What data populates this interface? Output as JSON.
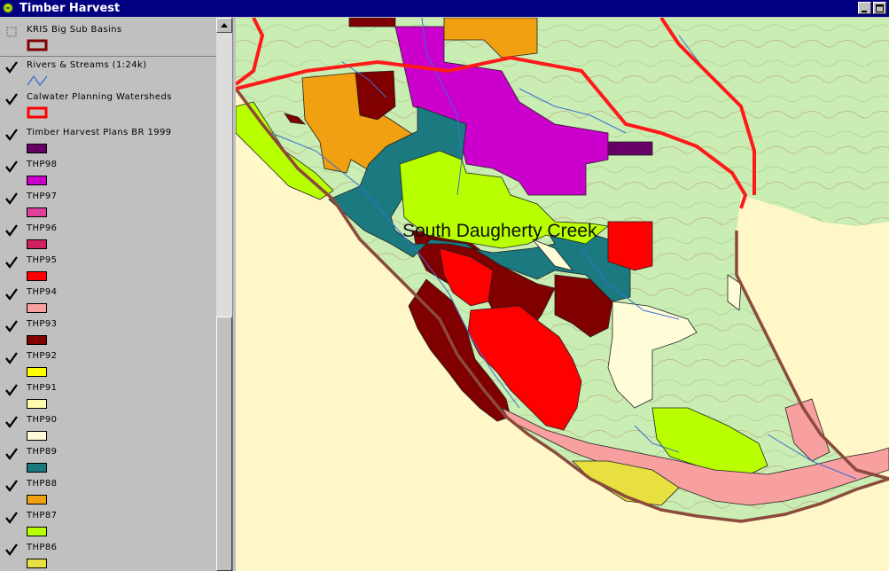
{
  "window": {
    "title": "Timber Harvest"
  },
  "toc": {
    "layers": [
      {
        "name": "KRIS Big Sub Basins",
        "checked": false,
        "symbol": "hollow-box",
        "color": "#800000"
      },
      {
        "name": "Rivers & Streams (1:24k)",
        "checked": true,
        "symbol": "line",
        "color": "#3366cc"
      },
      {
        "name": "Calwater Planning Watersheds",
        "checked": true,
        "symbol": "hollow-box",
        "color": "#ff0000"
      },
      {
        "name": "Timber Harvest Plans BR 1999",
        "checked": true,
        "symbol": "fill",
        "color": "#660066"
      },
      {
        "name": "THP98",
        "checked": true,
        "symbol": "fill",
        "color": "#cc00cc"
      },
      {
        "name": "THP97",
        "checked": true,
        "symbol": "fill",
        "color": "#e0409a"
      },
      {
        "name": "THP96",
        "checked": true,
        "symbol": "fill",
        "color": "#d02060"
      },
      {
        "name": "THP95",
        "checked": true,
        "symbol": "fill",
        "color": "#ff0000"
      },
      {
        "name": "THP94",
        "checked": true,
        "symbol": "fill",
        "color": "#f8a0a0"
      },
      {
        "name": "THP93",
        "checked": true,
        "symbol": "fill",
        "color": "#800000"
      },
      {
        "name": "THP92",
        "checked": true,
        "symbol": "fill",
        "color": "#ffff00"
      },
      {
        "name": "THP91",
        "checked": true,
        "symbol": "fill",
        "color": "#fffcb0"
      },
      {
        "name": "THP90",
        "checked": true,
        "symbol": "fill",
        "color": "#fffcd8"
      },
      {
        "name": "THP89",
        "checked": true,
        "symbol": "fill",
        "color": "#1a7a80"
      },
      {
        "name": "THP88",
        "checked": true,
        "symbol": "fill",
        "color": "#f0a010"
      },
      {
        "name": "THP87",
        "checked": true,
        "symbol": "fill",
        "color": "#b8ff00"
      },
      {
        "name": "THP86",
        "checked": true,
        "symbol": "fill",
        "color": "#e8e040"
      }
    ]
  },
  "map": {
    "label": "South Daugherty Creek",
    "colors": {
      "background": "#fff7c8",
      "topo": "#c8ecb0",
      "basin_outline": "#8b4a3c",
      "watershed": "#ff1a1a",
      "stream": "#3a6fd0"
    }
  }
}
